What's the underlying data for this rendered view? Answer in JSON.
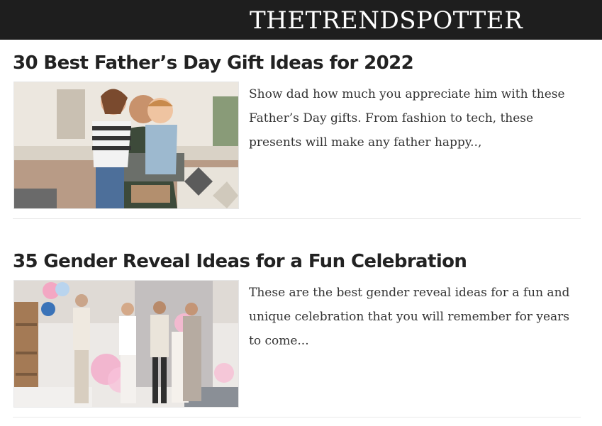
{
  "site": {
    "logo_part1": "The",
    "logo_part2": "Trend",
    "logo_part3": "Spotter"
  },
  "articles": [
    {
      "title": "30 Best Father’s Day Gift Ideas for 2022",
      "excerpt": "Show dad how much you appreciate him with these Father’s Day gifts. From fashion to tech, these presents will make any father happy..,",
      "image_icon": "family-photo"
    },
    {
      "title": "35 Gender Reveal Ideas for a Fun Celebration",
      "excerpt": "These are the best gender reveal ideas for a fun and unique celebration that you will remember for years to come...",
      "image_icon": "party-photo"
    }
  ],
  "colors": {
    "header_bg": "#1e1e1e",
    "title_text": "#222222",
    "body_text": "#333333"
  }
}
